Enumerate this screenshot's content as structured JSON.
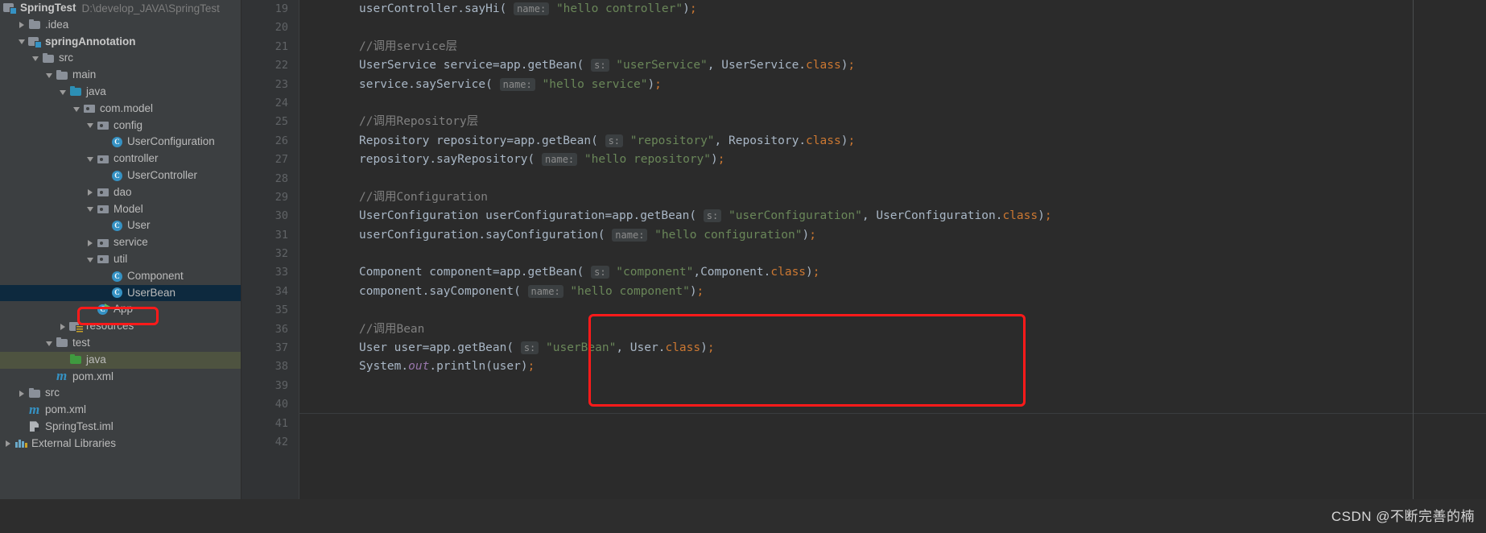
{
  "window": {
    "theme_bg": "#2b2b2b",
    "sidebar_bg": "#3c3f41",
    "accent_selected": "#0d293e",
    "accent_testsource": "#4e5340",
    "annotation_color": "#ff1a1a"
  },
  "project_tree": {
    "root_label": "SpringTest",
    "root_path": "D:\\develop_JAVA\\SpringTest",
    "items": [
      {
        "label": ".idea",
        "icon": "folder-icon",
        "indent": 1,
        "twisty": "closed",
        "selected": "none"
      },
      {
        "label": "springAnnotation",
        "icon": "module-icon",
        "indent": 1,
        "twisty": "open",
        "selected": "none",
        "bold": true
      },
      {
        "label": "src",
        "icon": "folder-icon",
        "indent": 2,
        "twisty": "open",
        "selected": "none"
      },
      {
        "label": "main",
        "icon": "folder-icon",
        "indent": 3,
        "twisty": "open",
        "selected": "none"
      },
      {
        "label": "java",
        "icon": "source-folder-icon",
        "indent": 4,
        "twisty": "open",
        "selected": "none"
      },
      {
        "label": "com.model",
        "icon": "package-icon",
        "indent": 5,
        "twisty": "open",
        "selected": "none"
      },
      {
        "label": "config",
        "icon": "package-icon",
        "indent": 6,
        "twisty": "open",
        "selected": "none"
      },
      {
        "label": "UserConfiguration",
        "icon": "java-class-icon",
        "indent": 7,
        "twisty": "none",
        "selected": "none"
      },
      {
        "label": "controller",
        "icon": "package-icon",
        "indent": 6,
        "twisty": "open",
        "selected": "none"
      },
      {
        "label": "UserController",
        "icon": "java-class-icon",
        "indent": 7,
        "twisty": "none",
        "selected": "none"
      },
      {
        "label": "dao",
        "icon": "package-icon",
        "indent": 6,
        "twisty": "closed",
        "selected": "none"
      },
      {
        "label": "Model",
        "icon": "package-icon",
        "indent": 6,
        "twisty": "open",
        "selected": "none"
      },
      {
        "label": "User",
        "icon": "java-class-icon",
        "indent": 7,
        "twisty": "none",
        "selected": "none"
      },
      {
        "label": "service",
        "icon": "package-icon",
        "indent": 6,
        "twisty": "closed",
        "selected": "none"
      },
      {
        "label": "util",
        "icon": "package-icon",
        "indent": 6,
        "twisty": "open",
        "selected": "none"
      },
      {
        "label": "Component",
        "icon": "java-class-icon",
        "indent": 7,
        "twisty": "none",
        "selected": "none"
      },
      {
        "label": "UserBean",
        "icon": "java-class-icon",
        "indent": 7,
        "twisty": "none",
        "selected": "blue"
      },
      {
        "label": "App",
        "icon": "java-runnable-class-icon",
        "indent": 6,
        "twisty": "none",
        "selected": "none",
        "annotated": true
      },
      {
        "label": "resources",
        "icon": "resource-folder-icon",
        "indent": 4,
        "twisty": "closed",
        "selected": "none"
      },
      {
        "label": "test",
        "icon": "folder-icon",
        "indent": 3,
        "twisty": "open",
        "selected": "none"
      },
      {
        "label": "java",
        "icon": "test-source-folder-icon",
        "indent": 4,
        "twisty": "none",
        "selected": "green"
      },
      {
        "label": "pom.xml",
        "icon": "maven-icon",
        "indent": 3,
        "twisty": "none",
        "selected": "none"
      },
      {
        "label": "src",
        "icon": "folder-icon",
        "indent": 1,
        "twisty": "closed",
        "selected": "none"
      },
      {
        "label": "pom.xml",
        "icon": "maven-icon",
        "indent": 1,
        "twisty": "none",
        "selected": "none"
      },
      {
        "label": "SpringTest.iml",
        "icon": "iml-file-icon",
        "indent": 1,
        "twisty": "none",
        "selected": "none"
      },
      {
        "label": "External Libraries",
        "icon": "library-icon",
        "indent": 0,
        "twisty": "closed",
        "selected": "none"
      }
    ]
  },
  "editor": {
    "first_line_number": 19,
    "line_numbers": [
      19,
      20,
      21,
      22,
      23,
      24,
      25,
      26,
      27,
      28,
      29,
      30,
      31,
      32,
      33,
      34,
      35,
      36,
      37,
      38,
      39,
      40,
      41,
      42
    ],
    "lines": [
      {
        "n": 19,
        "tokens": [
          {
            "t": "userController",
            "c": "ident"
          },
          {
            "t": ".",
            "c": "punc"
          },
          {
            "t": "sayHi",
            "c": "ident"
          },
          {
            "t": "(",
            "c": "punc"
          },
          {
            "t": " ",
            "c": "punc"
          },
          {
            "t": "name:",
            "c": "hint"
          },
          {
            "t": " ",
            "c": "punc"
          },
          {
            "t": "\"hello controller\"",
            "c": "str"
          },
          {
            "t": ")",
            "c": "punc"
          },
          {
            "t": ";",
            "c": "kw"
          }
        ]
      },
      {
        "n": 20,
        "tokens": []
      },
      {
        "n": 21,
        "tokens": [
          {
            "t": "//调用service层",
            "c": "cmt"
          }
        ]
      },
      {
        "n": 22,
        "tokens": [
          {
            "t": "UserService",
            "c": "type"
          },
          {
            "t": " service=app",
            "c": "ident"
          },
          {
            "t": ".",
            "c": "punc"
          },
          {
            "t": "getBean",
            "c": "ident"
          },
          {
            "t": "(",
            "c": "punc"
          },
          {
            "t": " ",
            "c": "punc"
          },
          {
            "t": "s:",
            "c": "hint"
          },
          {
            "t": " ",
            "c": "punc"
          },
          {
            "t": "\"userService\"",
            "c": "str"
          },
          {
            "t": ", ",
            "c": "punc"
          },
          {
            "t": "UserService",
            "c": "type"
          },
          {
            "t": ".",
            "c": "punc"
          },
          {
            "t": "class",
            "c": "kw"
          },
          {
            "t": ")",
            "c": "punc"
          },
          {
            "t": ";",
            "c": "kw"
          }
        ]
      },
      {
        "n": 23,
        "tokens": [
          {
            "t": "service",
            "c": "ident"
          },
          {
            "t": ".",
            "c": "punc"
          },
          {
            "t": "sayService",
            "c": "ident"
          },
          {
            "t": "(",
            "c": "punc"
          },
          {
            "t": " ",
            "c": "punc"
          },
          {
            "t": "name:",
            "c": "hint"
          },
          {
            "t": " ",
            "c": "punc"
          },
          {
            "t": "\"hello service\"",
            "c": "str"
          },
          {
            "t": ")",
            "c": "punc"
          },
          {
            "t": ";",
            "c": "kw"
          }
        ]
      },
      {
        "n": 24,
        "tokens": []
      },
      {
        "n": 25,
        "tokens": [
          {
            "t": "//调用Repository层",
            "c": "cmt"
          }
        ]
      },
      {
        "n": 26,
        "tokens": [
          {
            "t": "Repository",
            "c": "type"
          },
          {
            "t": " repository=app",
            "c": "ident"
          },
          {
            "t": ".",
            "c": "punc"
          },
          {
            "t": "getBean",
            "c": "ident"
          },
          {
            "t": "(",
            "c": "punc"
          },
          {
            "t": " ",
            "c": "punc"
          },
          {
            "t": "s:",
            "c": "hint"
          },
          {
            "t": " ",
            "c": "punc"
          },
          {
            "t": "\"repository\"",
            "c": "str"
          },
          {
            "t": ", ",
            "c": "punc"
          },
          {
            "t": "Repository",
            "c": "type"
          },
          {
            "t": ".",
            "c": "punc"
          },
          {
            "t": "class",
            "c": "kw"
          },
          {
            "t": ")",
            "c": "punc"
          },
          {
            "t": ";",
            "c": "kw"
          }
        ]
      },
      {
        "n": 27,
        "tokens": [
          {
            "t": "repository",
            "c": "ident"
          },
          {
            "t": ".",
            "c": "punc"
          },
          {
            "t": "sayRepository",
            "c": "ident"
          },
          {
            "t": "(",
            "c": "punc"
          },
          {
            "t": " ",
            "c": "punc"
          },
          {
            "t": "name:",
            "c": "hint"
          },
          {
            "t": " ",
            "c": "punc"
          },
          {
            "t": "\"hello repository\"",
            "c": "str"
          },
          {
            "t": ")",
            "c": "punc"
          },
          {
            "t": ";",
            "c": "kw"
          }
        ]
      },
      {
        "n": 28,
        "tokens": []
      },
      {
        "n": 29,
        "tokens": [
          {
            "t": "//调用Configuration",
            "c": "cmt"
          }
        ]
      },
      {
        "n": 30,
        "tokens": [
          {
            "t": "UserConfiguration",
            "c": "type"
          },
          {
            "t": " userConfiguration=app",
            "c": "ident"
          },
          {
            "t": ".",
            "c": "punc"
          },
          {
            "t": "getBean",
            "c": "ident"
          },
          {
            "t": "(",
            "c": "punc"
          },
          {
            "t": " ",
            "c": "punc"
          },
          {
            "t": "s:",
            "c": "hint"
          },
          {
            "t": " ",
            "c": "punc"
          },
          {
            "t": "\"userConfiguration\"",
            "c": "str"
          },
          {
            "t": ", ",
            "c": "punc"
          },
          {
            "t": "UserConfiguration",
            "c": "type"
          },
          {
            "t": ".",
            "c": "punc"
          },
          {
            "t": "class",
            "c": "kw"
          },
          {
            "t": ")",
            "c": "punc"
          },
          {
            "t": ";",
            "c": "kw"
          }
        ]
      },
      {
        "n": 31,
        "tokens": [
          {
            "t": "userConfiguration",
            "c": "ident"
          },
          {
            "t": ".",
            "c": "punc"
          },
          {
            "t": "sayConfiguration",
            "c": "ident"
          },
          {
            "t": "(",
            "c": "punc"
          },
          {
            "t": " ",
            "c": "punc"
          },
          {
            "t": "name:",
            "c": "hint"
          },
          {
            "t": " ",
            "c": "punc"
          },
          {
            "t": "\"hello configuration\"",
            "c": "str"
          },
          {
            "t": ")",
            "c": "punc"
          },
          {
            "t": ";",
            "c": "kw"
          }
        ]
      },
      {
        "n": 32,
        "tokens": []
      },
      {
        "n": 33,
        "tokens": [
          {
            "t": "Component",
            "c": "type"
          },
          {
            "t": " component=app",
            "c": "ident"
          },
          {
            "t": ".",
            "c": "punc"
          },
          {
            "t": "getBean",
            "c": "ident"
          },
          {
            "t": "(",
            "c": "punc"
          },
          {
            "t": " ",
            "c": "punc"
          },
          {
            "t": "s:",
            "c": "hint"
          },
          {
            "t": " ",
            "c": "punc"
          },
          {
            "t": "\"component\"",
            "c": "str"
          },
          {
            "t": ",",
            "c": "punc"
          },
          {
            "t": "Component",
            "c": "type"
          },
          {
            "t": ".",
            "c": "punc"
          },
          {
            "t": "class",
            "c": "kw"
          },
          {
            "t": ")",
            "c": "punc"
          },
          {
            "t": ";",
            "c": "kw"
          }
        ]
      },
      {
        "n": 34,
        "tokens": [
          {
            "t": "component",
            "c": "ident"
          },
          {
            "t": ".",
            "c": "punc"
          },
          {
            "t": "sayComponent",
            "c": "ident"
          },
          {
            "t": "(",
            "c": "punc"
          },
          {
            "t": " ",
            "c": "punc"
          },
          {
            "t": "name:",
            "c": "hint"
          },
          {
            "t": " ",
            "c": "punc"
          },
          {
            "t": "\"hello component\"",
            "c": "str"
          },
          {
            "t": ")",
            "c": "punc"
          },
          {
            "t": ";",
            "c": "kw"
          }
        ]
      },
      {
        "n": 35,
        "tokens": []
      },
      {
        "n": 36,
        "tokens": [
          {
            "t": "//调用Bean",
            "c": "cmt"
          }
        ]
      },
      {
        "n": 37,
        "tokens": [
          {
            "t": "User",
            "c": "type"
          },
          {
            "t": " user=app",
            "c": "ident"
          },
          {
            "t": ".",
            "c": "punc"
          },
          {
            "t": "getBean",
            "c": "ident"
          },
          {
            "t": "(",
            "c": "punc"
          },
          {
            "t": " ",
            "c": "punc"
          },
          {
            "t": "s:",
            "c": "hint"
          },
          {
            "t": " ",
            "c": "punc"
          },
          {
            "t": "\"userBean\"",
            "c": "str"
          },
          {
            "t": ", ",
            "c": "punc"
          },
          {
            "t": "User",
            "c": "type"
          },
          {
            "t": ".",
            "c": "punc"
          },
          {
            "t": "class",
            "c": "kw"
          },
          {
            "t": ")",
            "c": "punc"
          },
          {
            "t": ";",
            "c": "kw"
          }
        ]
      },
      {
        "n": 38,
        "tokens": [
          {
            "t": "System",
            "c": "type"
          },
          {
            "t": ".",
            "c": "punc"
          },
          {
            "t": "out",
            "c": "field"
          },
          {
            "t": ".",
            "c": "punc"
          },
          {
            "t": "println",
            "c": "ident"
          },
          {
            "t": "(",
            "c": "punc"
          },
          {
            "t": "user",
            "c": "ident"
          },
          {
            "t": ")",
            "c": "punc"
          },
          {
            "t": ";",
            "c": "kw"
          }
        ]
      },
      {
        "n": 39,
        "tokens": []
      },
      {
        "n": 40,
        "tokens": []
      },
      {
        "n": 41,
        "tokens": []
      },
      {
        "n": 42,
        "tokens": []
      }
    ]
  },
  "annotations": [
    {
      "name": "app-highlight-box",
      "target": "App"
    },
    {
      "name": "bean-code-highlight-box",
      "target": "//调用Bean block"
    }
  ],
  "watermark": {
    "text": "CSDN @不断完善的楠"
  }
}
